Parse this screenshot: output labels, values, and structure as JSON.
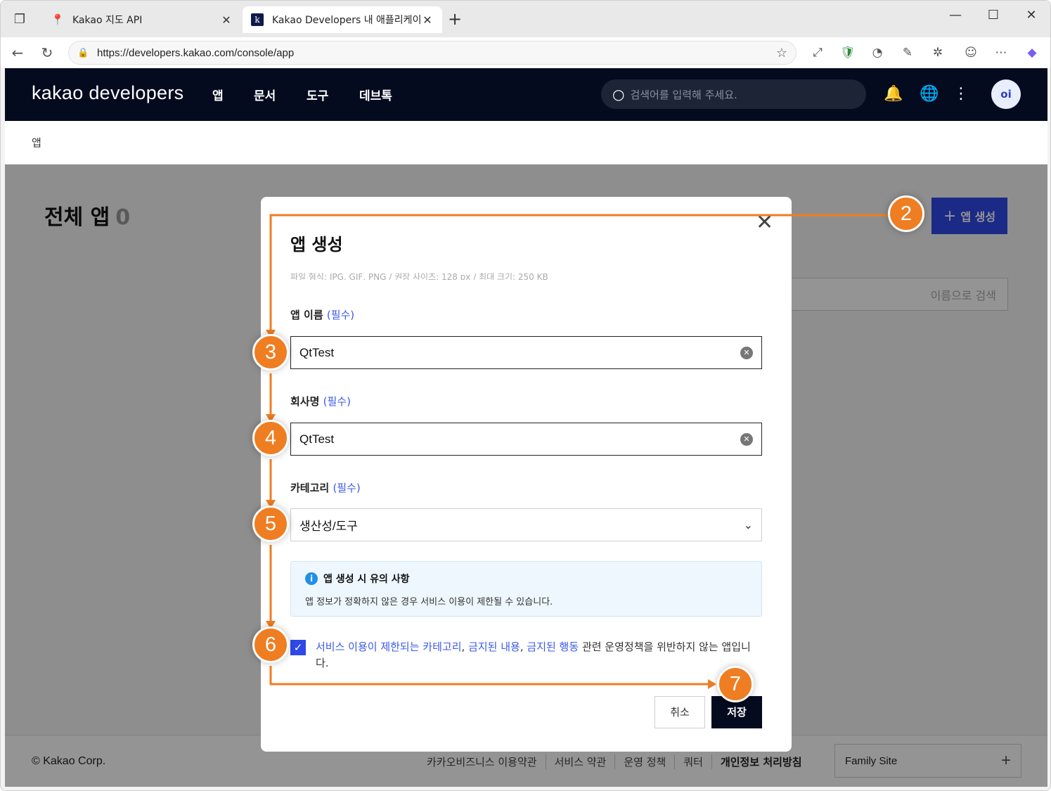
{
  "browser": {
    "tabs": [
      {
        "title": "Kakao 지도 API",
        "icon": "map-pin-icon"
      },
      {
        "title": "Kakao Developers 내 애플리케이",
        "icon": "kakao-k-icon"
      }
    ],
    "url": "https://developers.kakao.com/console/app"
  },
  "header": {
    "logo": "kakao developers",
    "nav": [
      "앱",
      "문서",
      "도구",
      "데브톡"
    ],
    "search_placeholder": "검색어를 입력해 주세요.",
    "avatar": "oi"
  },
  "breadcrumb": "앱",
  "page": {
    "title": "전체 앱",
    "count": "0",
    "create_button": "앱 생성",
    "search_placeholder": "이름으로 검색"
  },
  "modal": {
    "title": "앱 생성",
    "cutoff_text": "파일 형식: JPG, GIF, PNG / 권장 사이즈: 128 px / 최대 크기: 250 KB",
    "required": "(필수)",
    "app_name_label": "앱 이름",
    "app_name_value": "QtTest",
    "company_label": "회사명",
    "company_value": "QtTest",
    "category_label": "카테고리",
    "category_value": "생산성/도구",
    "notice_title": "앱 생성 시 유의 사항",
    "notice_body": "앱 정보가 정확하지 않은 경우 서비스 이용이 제한될 수 있습니다.",
    "agree_links": [
      "서비스 이용이 제한되는 카테고리",
      "금지된 내용",
      "금지된 행동"
    ],
    "agree_sep": ", ",
    "agree_rest": " 관련 운영정책을 위반하지 않는 앱입니다.",
    "agree_checked": true,
    "cancel": "취소",
    "save": "저장"
  },
  "footer": {
    "copyright": "© Kakao Corp.",
    "links": [
      "카카오비즈니스 이용약관",
      "서비스 약관",
      "운영 정책",
      "쿼터",
      "개인정보 처리방침"
    ],
    "family_site": "Family Site"
  },
  "annotations": {
    "steps": [
      "2",
      "3",
      "4",
      "5",
      "6",
      "7"
    ],
    "color": "#ef7d22"
  }
}
